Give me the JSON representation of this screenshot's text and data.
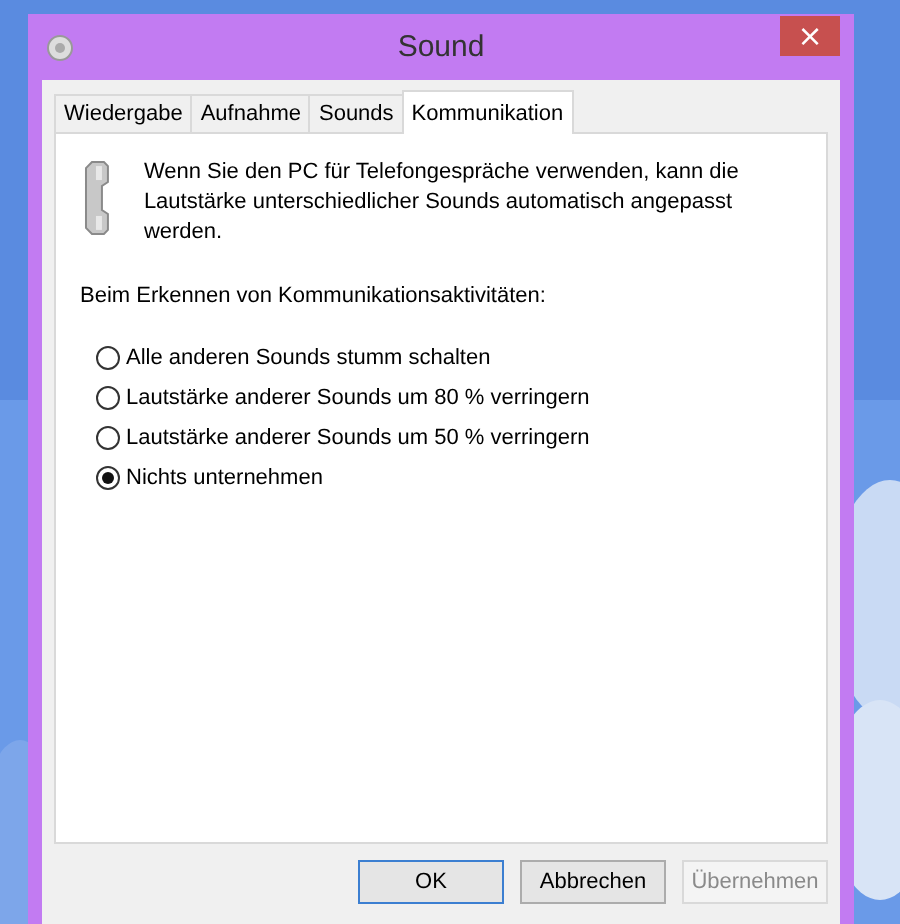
{
  "window": {
    "title": "Sound",
    "close": "×"
  },
  "tabs": [
    {
      "label": "Wiedergabe",
      "selected": false
    },
    {
      "label": "Aufnahme",
      "selected": false
    },
    {
      "label": "Sounds",
      "selected": false
    },
    {
      "label": "Kommunikation",
      "selected": true
    }
  ],
  "description": "Wenn Sie den PC für Telefongespräche verwenden, kann die Lautstärke unterschiedlicher Sounds automatisch angepasst werden.",
  "prompt": "Beim Erkennen von Kommunikationsaktivitäten:",
  "options": [
    {
      "label": "Alle anderen Sounds stumm schalten",
      "selected": false
    },
    {
      "label": "Lautstärke anderer Sounds um 80 % verringern",
      "selected": false
    },
    {
      "label": "Lautstärke anderer Sounds um 50 % verringern",
      "selected": false
    },
    {
      "label": "Nichts unternehmen",
      "selected": true
    }
  ],
  "buttons": [
    {
      "label": "OK",
      "kind": "default",
      "disabled": false
    },
    {
      "label": "Abbrechen",
      "kind": "normal",
      "disabled": false
    },
    {
      "label": "Übernehmen",
      "kind": "normal",
      "disabled": true
    }
  ]
}
